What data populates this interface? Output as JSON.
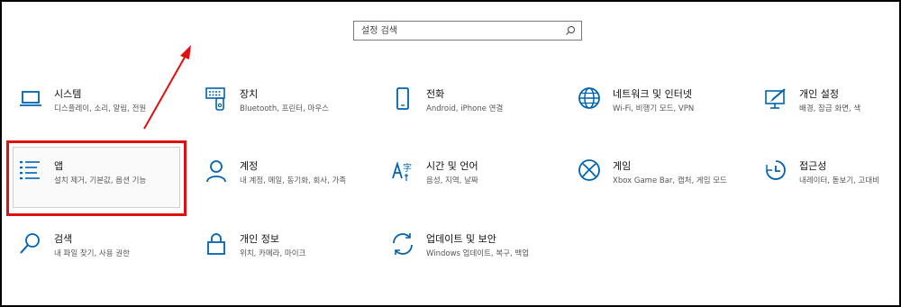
{
  "search": {
    "placeholder": "설정 검색"
  },
  "tiles": [
    {
      "title": "시스템",
      "desc": "디스플레이, 소리, 알림, 전원",
      "icon": "laptop-icon"
    },
    {
      "title": "장치",
      "desc": "Bluetooth, 프린터, 마우스",
      "icon": "keyboard-icon"
    },
    {
      "title": "전화",
      "desc": "Android, iPhone 연결",
      "icon": "phone-icon"
    },
    {
      "title": "네트워크 및 인터넷",
      "desc": "Wi-Fi, 비행기 모드, VPN",
      "icon": "globe-icon"
    },
    {
      "title": "개인 설정",
      "desc": "배경, 잠금 화면, 색",
      "icon": "personalization-icon"
    },
    {
      "title": "앱",
      "desc": "설치 제거, 기본값, 옵션 기능",
      "icon": "apps-list-icon"
    },
    {
      "title": "계정",
      "desc": "내 계정, 메일, 동기화, 회사, 가족",
      "icon": "person-icon"
    },
    {
      "title": "시간 및 언어",
      "desc": "음성, 지역, 날짜",
      "icon": "time-language-icon"
    },
    {
      "title": "게임",
      "desc": "Xbox Game Bar, 캡처, 게임 모드",
      "icon": "xbox-icon"
    },
    {
      "title": "접근성",
      "desc": "내레이터, 돋보기, 고대비",
      "icon": "accessibility-icon"
    },
    {
      "title": "검색",
      "desc": "내 파일 찾기, 사용 권한",
      "icon": "search-icon"
    },
    {
      "title": "개인 정보",
      "desc": "위치, 카메라, 마이크",
      "icon": "lock-icon"
    },
    {
      "title": "업데이트 및 보안",
      "desc": "Windows 업데이트, 복구, 백업",
      "icon": "sync-icon"
    }
  ],
  "colors": {
    "accent": "#0063b1",
    "highlight": "#e01010"
  }
}
